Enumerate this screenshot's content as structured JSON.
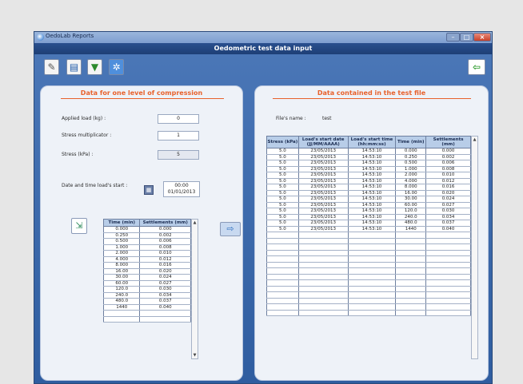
{
  "window": {
    "app_title": "OedoLab Reports",
    "form_title": "Oedometric test data input"
  },
  "toolbar": {
    "new": "new-icon",
    "open": "open-icon",
    "save": "save-icon",
    "settings": "gear-icon",
    "exit": "exit-icon"
  },
  "left": {
    "title": "Data for one level of compression",
    "applied_load_label": "Applied load (kg) :",
    "applied_load_value": "0",
    "stress_mult_label": "Stress multiplicator :",
    "stress_mult_value": "1",
    "stress_label": "Stress (kPa) :",
    "stress_value": "5",
    "datetime_label": "Date and time load's start :",
    "time_value": "00:00",
    "date_value": "01/01/2013",
    "table": {
      "headers": [
        "Time (min)",
        "Settlements (mm)"
      ],
      "rows": [
        [
          "0.000",
          "0.000"
        ],
        [
          "0.250",
          "0.002"
        ],
        [
          "0.500",
          "0.006"
        ],
        [
          "1.000",
          "0.008"
        ],
        [
          "2.000",
          "0.010"
        ],
        [
          "4.000",
          "0.012"
        ],
        [
          "8.000",
          "0.016"
        ],
        [
          "16.00",
          "0.020"
        ],
        [
          "30.00",
          "0.024"
        ],
        [
          "60.00",
          "0.027"
        ],
        [
          "120.0",
          "0.030"
        ],
        [
          "240.0",
          "0.034"
        ],
        [
          "480.0",
          "0.037"
        ],
        [
          "1440",
          "0.040"
        ],
        [
          "",
          ""
        ],
        [
          "",
          ""
        ]
      ]
    }
  },
  "right": {
    "title": "Data contained in the test file",
    "file_label": "File's name :",
    "file_value": "test",
    "table": {
      "headers": [
        "Stress (kPa)",
        "Load's start date (JJ/MM/AAAA)",
        "Load's start time (hh:mm:ss)",
        "Time (min)",
        "Settlements (mm)"
      ],
      "rows": [
        [
          "5.0",
          "23/05/2013",
          "14:53:10",
          "0.000",
          "0.000"
        ],
        [
          "5.0",
          "23/05/2013",
          "14:53:10",
          "0.250",
          "0.002"
        ],
        [
          "5.0",
          "23/05/2013",
          "14:53:10",
          "0.500",
          "0.006"
        ],
        [
          "5.0",
          "23/05/2013",
          "14:53:10",
          "1.000",
          "0.008"
        ],
        [
          "5.0",
          "23/05/2013",
          "14:53:10",
          "2.000",
          "0.010"
        ],
        [
          "5.0",
          "23/05/2013",
          "14:53:10",
          "4.000",
          "0.012"
        ],
        [
          "5.0",
          "23/05/2013",
          "14:53:10",
          "8.000",
          "0.016"
        ],
        [
          "5.0",
          "23/05/2013",
          "14:53:10",
          "16.00",
          "0.020"
        ],
        [
          "5.0",
          "23/05/2013",
          "14:53:10",
          "30.00",
          "0.024"
        ],
        [
          "5.0",
          "23/05/2013",
          "14:53:10",
          "60.00",
          "0.027"
        ],
        [
          "5.0",
          "23/05/2013",
          "14:53:10",
          "120.0",
          "0.030"
        ],
        [
          "5.0",
          "23/05/2013",
          "14:53:10",
          "240.0",
          "0.034"
        ],
        [
          "5.0",
          "23/05/2013",
          "14:53:10",
          "480.0",
          "0.037"
        ],
        [
          "5.0",
          "23/05/2013",
          "14:53:10",
          "1440",
          "0.040"
        ],
        [
          "",
          "",
          "",
          "",
          ""
        ],
        [
          "",
          "",
          "",
          "",
          ""
        ],
        [
          "",
          "",
          "",
          "",
          ""
        ],
        [
          "",
          "",
          "",
          "",
          ""
        ],
        [
          "",
          "",
          "",
          "",
          ""
        ],
        [
          "",
          "",
          "",
          "",
          ""
        ],
        [
          "",
          "",
          "",
          "",
          ""
        ],
        [
          "",
          "",
          "",
          "",
          ""
        ],
        [
          "",
          "",
          "",
          "",
          ""
        ],
        [
          "",
          "",
          "",
          "",
          ""
        ],
        [
          "",
          "",
          "",
          "",
          ""
        ],
        [
          "",
          "",
          "",
          "",
          ""
        ],
        [
          "",
          "",
          "",
          "",
          ""
        ],
        [
          "",
          "",
          "",
          "",
          ""
        ]
      ]
    }
  }
}
